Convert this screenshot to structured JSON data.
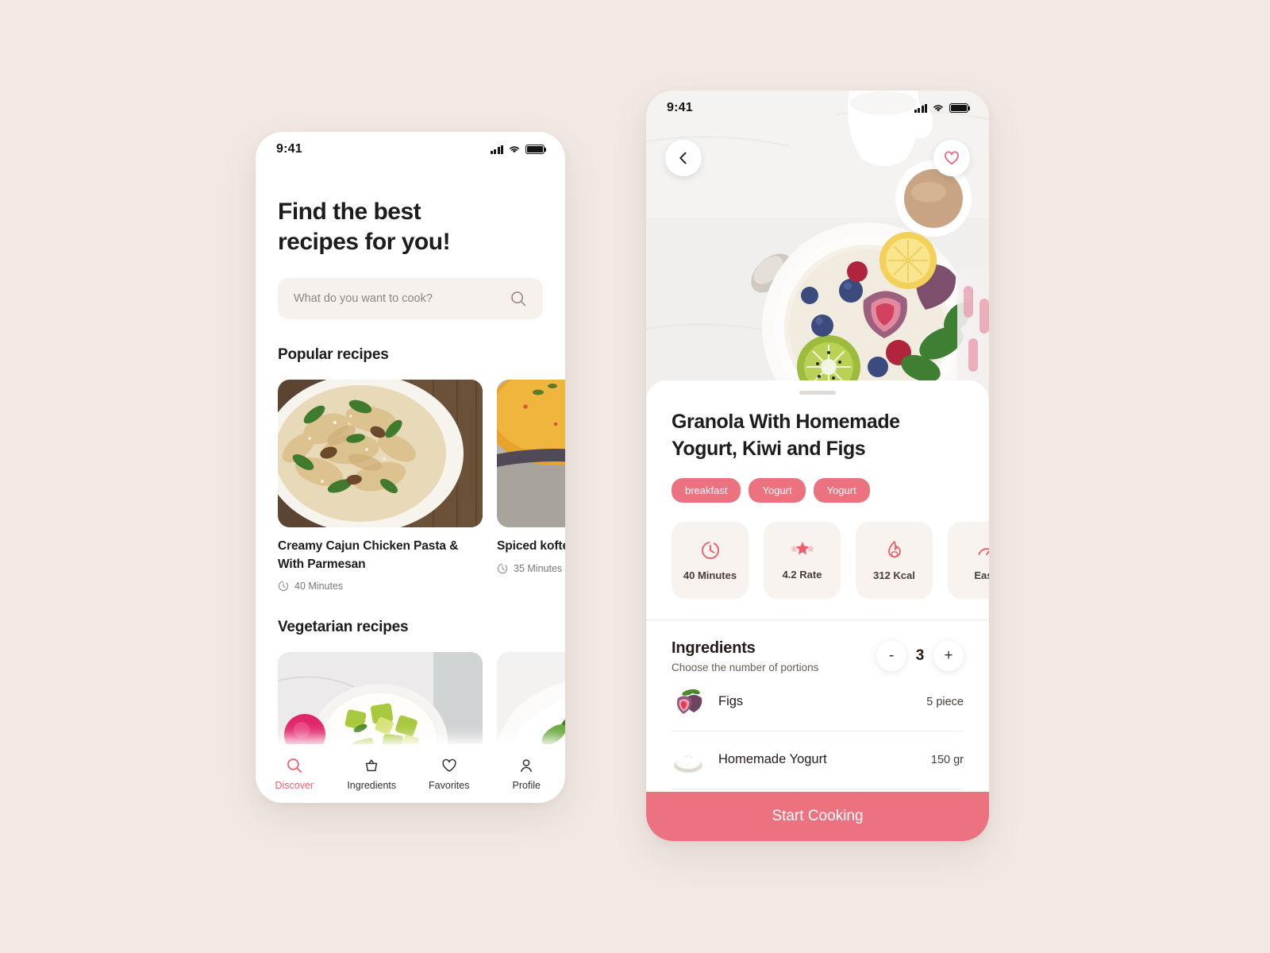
{
  "accent": "#ec7280",
  "background": "#f2e9e4",
  "discover": {
    "status": {
      "time": "9:41"
    },
    "heading": "Find the best\nrecipes for you!",
    "search": {
      "placeholder": "What do you want to cook?",
      "value": ""
    },
    "sections": [
      {
        "title": "Popular recipes",
        "cards": [
          {
            "name": "Creamy Cajun Chicken Pasta & With Parmesan",
            "time": "40 Minutes"
          },
          {
            "name": "Spiced kofte with chickpeas",
            "time": "35 Minutes"
          }
        ]
      },
      {
        "title": "Vegetarian recipes",
        "cards": [
          {
            "name": "",
            "time": ""
          },
          {
            "name": "",
            "time": ""
          }
        ]
      }
    ],
    "tabs": [
      {
        "label": "Discover",
        "icon": "search-icon",
        "active": true
      },
      {
        "label": "Ingredients",
        "icon": "basket-icon",
        "active": false
      },
      {
        "label": "Favorites",
        "icon": "heart-icon",
        "active": false
      },
      {
        "label": "Profile",
        "icon": "person-icon",
        "active": false
      }
    ]
  },
  "detail": {
    "status": {
      "time": "9:41"
    },
    "back_icon": "chevron-left-icon",
    "favorite_icon": "heart-icon",
    "title": "Granola With Homemade Yogurt, Kiwi and Figs",
    "tags": [
      "breakfast",
      "Yogurt",
      "Yogurt"
    ],
    "stats": [
      {
        "label": "40 Minutes",
        "icon": "clock-icon"
      },
      {
        "label": "4.2 Rate",
        "icon": "star-icon"
      },
      {
        "label": "312 Kcal",
        "icon": "flame-icon"
      },
      {
        "label": "Easy",
        "icon": "gauge-icon"
      }
    ],
    "ingredients_section": {
      "title": "Ingredients",
      "subtitle": "Choose the number of portions",
      "stepper": {
        "minus": "-",
        "value": "3",
        "plus": "+"
      },
      "rows": [
        {
          "name": "Figs",
          "qty": "5 piece",
          "icon": "figs-icon"
        },
        {
          "name": "Homemade Yogurt",
          "qty": "150 gr",
          "icon": "yogurt-icon"
        }
      ]
    },
    "cta": "Start Cooking"
  }
}
